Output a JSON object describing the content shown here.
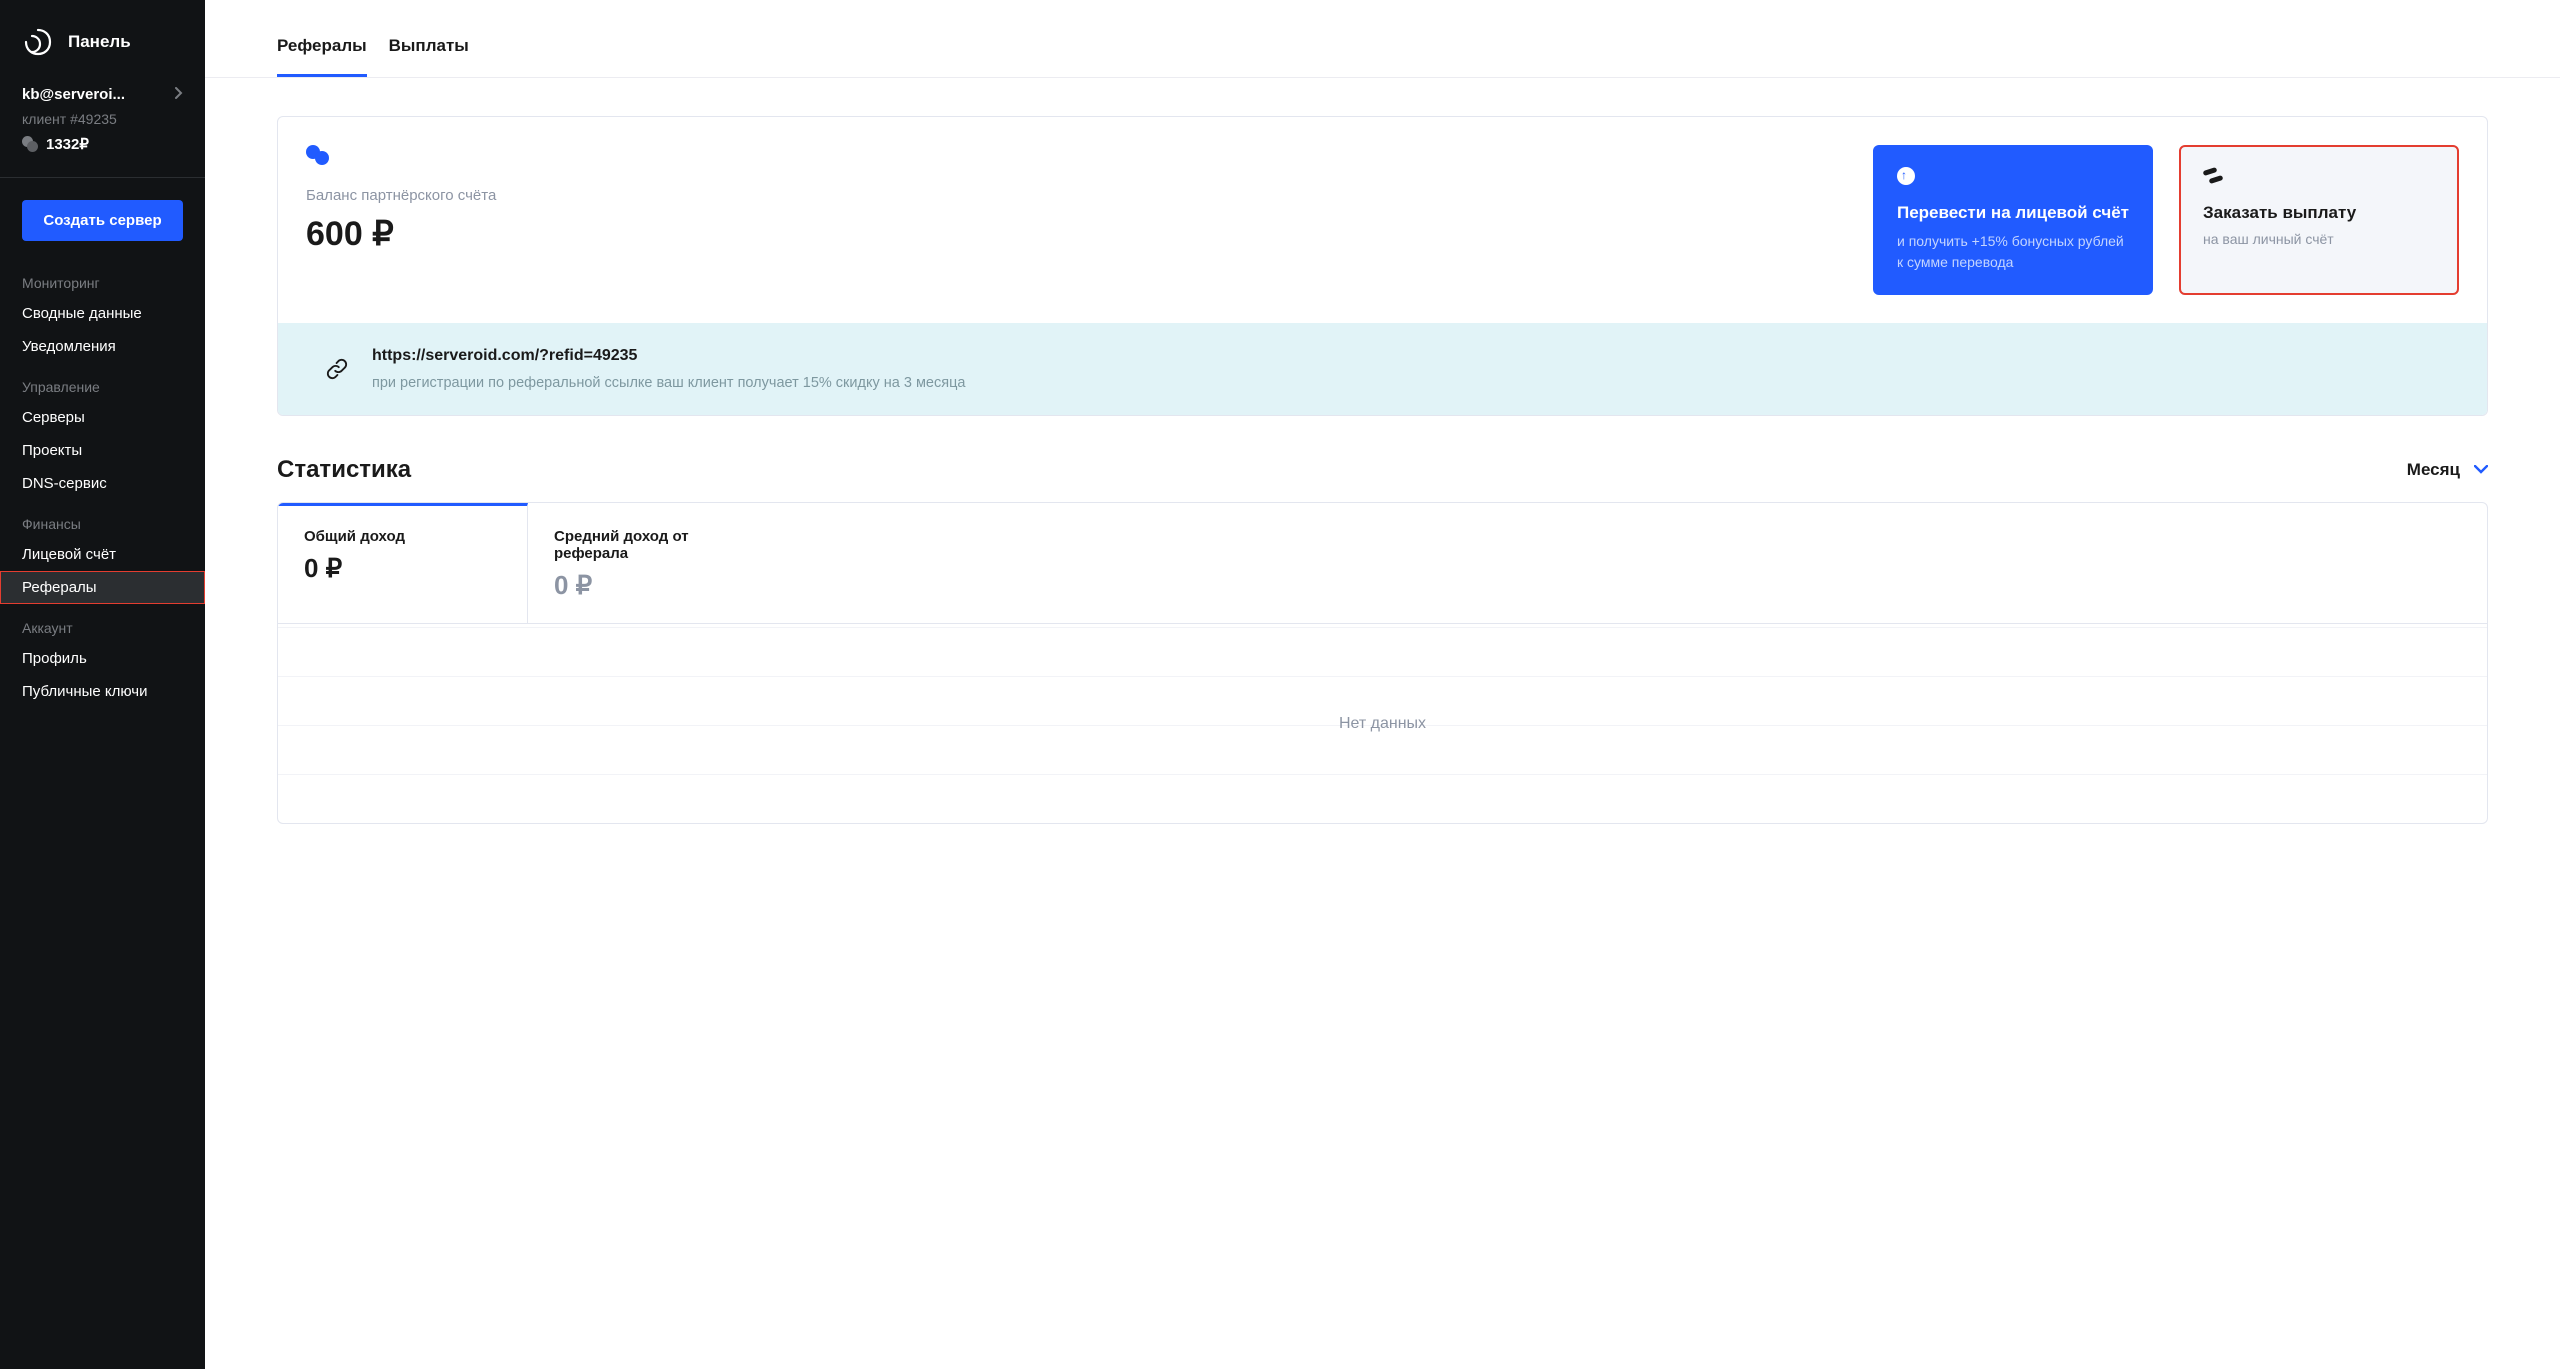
{
  "sidebar": {
    "panel_title": "Панель",
    "user_email": "kb@serveroi...",
    "user_sub": "клиент #49235",
    "balance": "1332₽",
    "create_button": "Создать сервер",
    "groups": [
      {
        "heading": "Мониторинг",
        "items": [
          "Сводные данные",
          "Уведомления"
        ]
      },
      {
        "heading": "Управление",
        "items": [
          "Серверы",
          "Проекты",
          "DNS-сервис"
        ]
      },
      {
        "heading": "Финансы",
        "items": [
          "Лицевой счёт",
          "Рефералы"
        ]
      },
      {
        "heading": "Аккаунт",
        "items": [
          "Профиль",
          "Публичные ключи"
        ]
      }
    ]
  },
  "tabs": {
    "referrals": "Рефералы",
    "payouts": "Выплаты"
  },
  "balance_block": {
    "label": "Баланс партнёрского счёта",
    "value": "600 ₽"
  },
  "action_transfer": {
    "title": "Перевести на лицевой счёт",
    "sub": "и получить +15% бонусных рублей к сумме перевода"
  },
  "action_payout": {
    "title": "Заказать выплату",
    "sub": "на ваш личный счёт"
  },
  "ref_link": {
    "url": "https://serveroid.com/?refid=49235",
    "sub": "при регистрации по реферальной ссылке ваш клиент получает 15% скидку на 3 месяца"
  },
  "stats": {
    "title": "Статистика",
    "period": "Месяц",
    "tabs": {
      "total": {
        "label": "Общий доход",
        "value": "0 ₽"
      },
      "avg": {
        "label": "Средний доход от реферала",
        "value": "0 ₽"
      }
    },
    "no_data": "Нет данных"
  }
}
